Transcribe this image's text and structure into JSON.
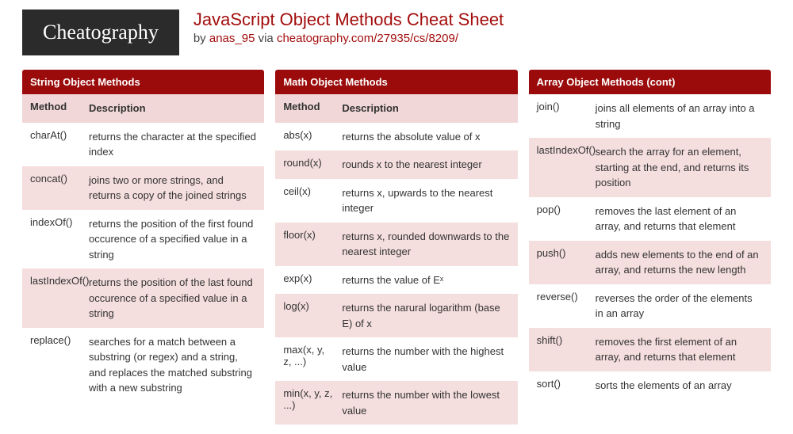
{
  "brand": "Cheatography",
  "title": "JavaScript Object Methods Cheat Sheet",
  "byline_prefix": "by ",
  "author": "anas_95",
  "byline_via": " via ",
  "link": "cheatography.com/27935/cs/8209/",
  "col1": {
    "header": "String Object Methods",
    "th_method": "Method",
    "th_desc": "Description",
    "rows": [
      {
        "m": "charAt()",
        "d": "returns the character at the specified index"
      },
      {
        "m": "concat()",
        "d": "joins two or more strings, and returns a copy of the joined strings"
      },
      {
        "m": "indexOf()",
        "d": "returns the position of the first found occurence of a specified value in a string"
      },
      {
        "m": "lastIndexOf()",
        "d": "returns the position of the last found occurence of a specified value in a string"
      },
      {
        "m": "replace()",
        "d": "searches for a match between a substring (or regex) and a string, and replaces the matched substring with a new substring"
      }
    ]
  },
  "col2": {
    "header": "Math Object Methods",
    "th_method": "Method",
    "th_desc": "Description",
    "rows": [
      {
        "m": "abs(x)",
        "d": "returns the absolute value of x"
      },
      {
        "m": "round(x)",
        "d": "rounds x to the nearest integer"
      },
      {
        "m": "ceil(x)",
        "d": "returns x, upwards to the nearest integer"
      },
      {
        "m": "floor(x)",
        "d": "returns x, rounded downwards to the nearest integer"
      },
      {
        "m": "exp(x)",
        "d": "returns the value of Eˣ"
      },
      {
        "m": "log(x)",
        "d": "returns the narural logarithm (base E) of x"
      },
      {
        "m": "max(x, y, z, ...)",
        "d": "returns the number with the highest value"
      },
      {
        "m": "min(x, y, z, ...)",
        "d": "returns the number with the lowest value"
      }
    ]
  },
  "col3": {
    "header": "Array Object Methods (cont)",
    "rows": [
      {
        "m": "join()",
        "d": "joins all elements of an array into a string"
      },
      {
        "m": "lastIndexOf()",
        "d": "search the array for an element, starting at the end, and returns its position"
      },
      {
        "m": "pop()",
        "d": "removes the last element of an array, and returns that element"
      },
      {
        "m": "push()",
        "d": "adds new elements to the end of an array, and returns the new length"
      },
      {
        "m": "reverse()",
        "d": "reverses the order of the elements in an array"
      },
      {
        "m": "shift()",
        "d": "removes the first element of an array, and returns that element"
      },
      {
        "m": "sort()",
        "d": "sorts the elements of an array"
      }
    ]
  }
}
